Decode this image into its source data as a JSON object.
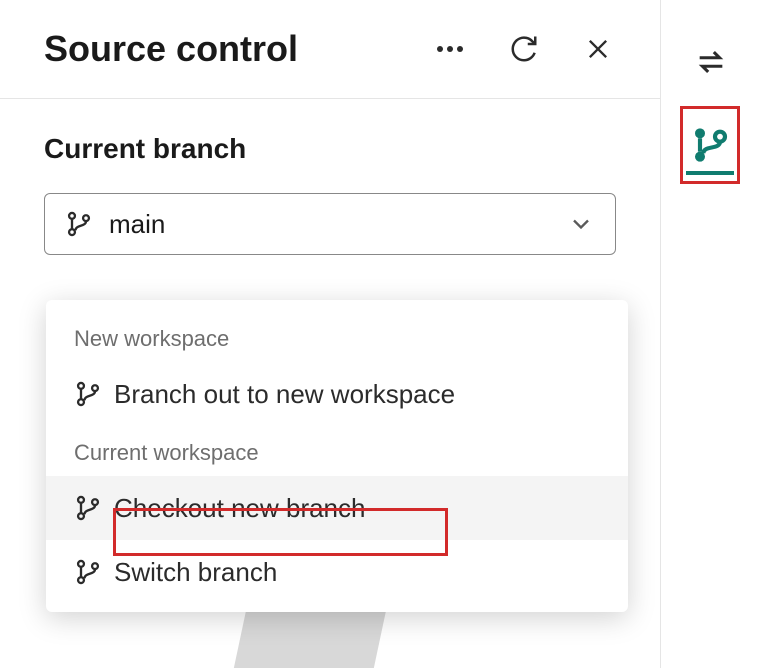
{
  "header": {
    "title": "Source control"
  },
  "section": {
    "title": "Current branch"
  },
  "branch_select": {
    "value": "main"
  },
  "dropdown": {
    "groups": [
      {
        "label": "New workspace",
        "items": [
          {
            "label": "Branch out to new workspace",
            "selected": false
          }
        ]
      },
      {
        "label": "Current workspace",
        "items": [
          {
            "label": "Checkout new branch",
            "selected": true
          },
          {
            "label": "Switch branch",
            "selected": false
          }
        ]
      }
    ]
  }
}
